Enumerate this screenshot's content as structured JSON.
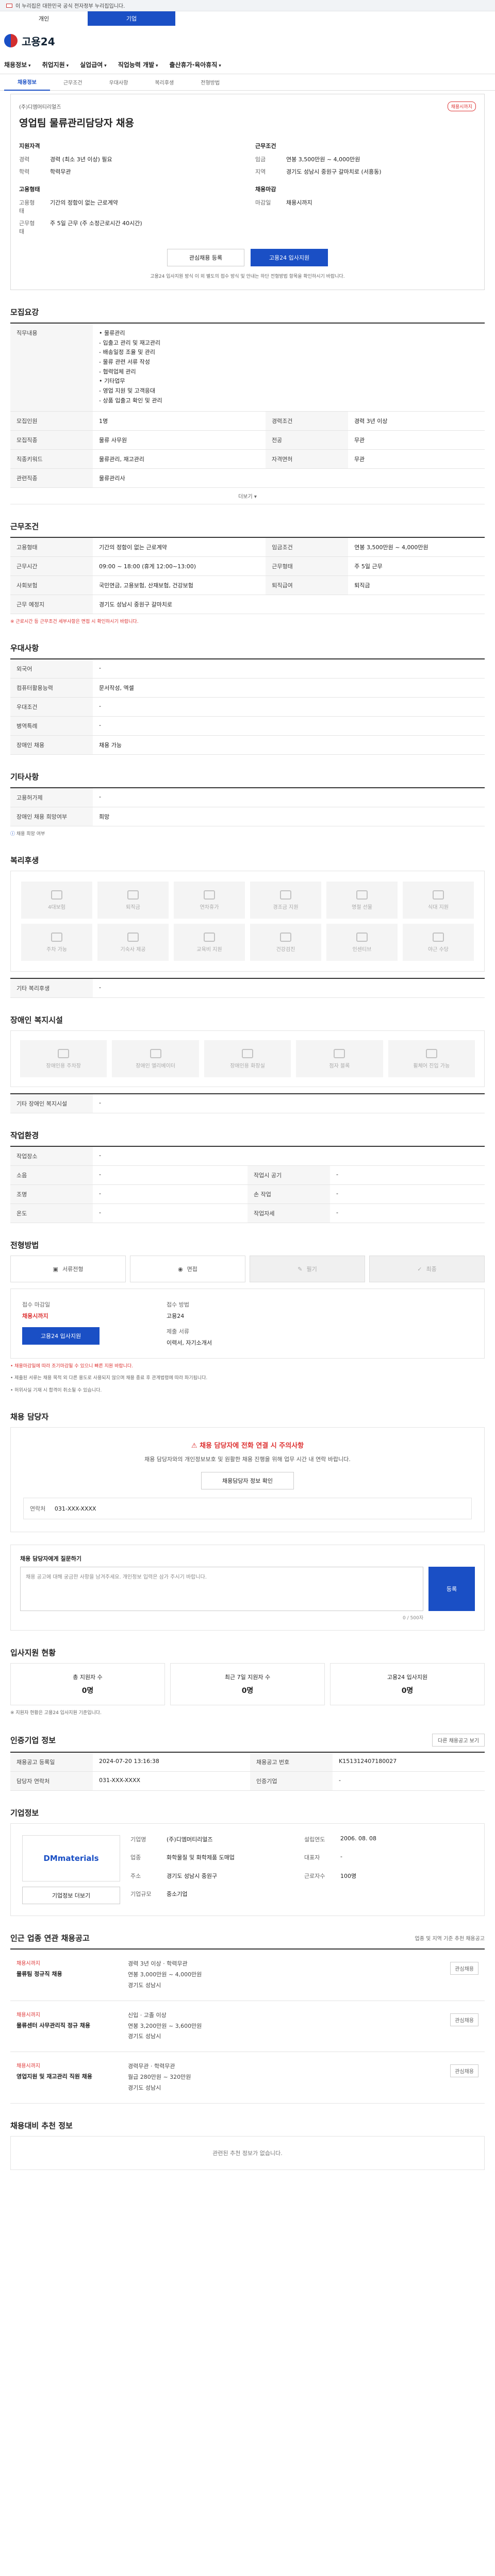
{
  "gov_banner": "이 누리집은 대한민국 공식 전자정부 누리집입니다.",
  "top_tabs": [
    "개인",
    "기업"
  ],
  "logo": "고용24",
  "gnb": [
    "채용정보",
    "취업지원",
    "실업급여",
    "직업능력 개발",
    "출산휴가·육아휴직"
  ],
  "subnav": [
    "채용정보",
    "근무조건",
    "우대사항",
    "복리후생",
    "전형방법"
  ],
  "summary": {
    "company": "(주)디엠머티리얼즈",
    "badge": "채용시까지",
    "title": "영업팀 물류관리담당자 채용",
    "left_heading": "지원자격",
    "left_kv": [
      [
        "경력",
        "경력 (최소 3년 이상) 필요"
      ],
      [
        "학력",
        "학력무관"
      ]
    ],
    "left2_heading": "고용형태",
    "left2_kv": [
      [
        "고용형태",
        "기간의 정함이 없는 근로계약"
      ],
      [
        "근무형태",
        "주 5일 근무 (주 소정근로시간 40시간)"
      ]
    ],
    "right_heading": "근무조건",
    "right_kv": [
      [
        "임금",
        "연봉 3,500만원 ~ 4,000만원"
      ],
      [
        "지역",
        "경기도 성남시 중원구 갈마치로 (서흥동)"
      ]
    ],
    "right2_heading": "채용마감",
    "right2_kv": [
      [
        "마감일",
        "채용시까지"
      ]
    ],
    "btn_scrap": "관심채용 등록",
    "btn_apply": "고용24 입사지원",
    "note": "고용24 입사지원 방식 이 외 별도의 접수 방식 및 안내는 하단 전형방법 항목을 확인하시기 바랍니다."
  },
  "sections": {
    "recruit": "모집요강",
    "conditions": "근무조건",
    "preference": "우대사항",
    "other": "기타사항",
    "welfare": "복리후생",
    "disability": "장애인 복지시설",
    "environment": "작업환경",
    "selection": "전형방법",
    "contact": "채용 담당자",
    "applicants": "입사지원 현황",
    "manager": "인증기업 정보",
    "company": "기업정보",
    "related": "인근 업종 연관 채용공고",
    "nearby": "채용대비 추천 정보"
  },
  "recruit": {
    "rows": [
      [
        "직무내용",
        "• 물류관리\n  - 입출고 관리 및 재고관리\n  - 배송일정 조율 및 관리\n  - 물류 관련 서류 작성\n  - 협력업체 관리\n• 기타업무\n  - 영업 지원 및 고객응대\n  - 상품 입출고 확인 및 관리"
      ],
      [
        "모집인원",
        "1명"
      ],
      [
        "모집직종",
        "물류 사무원"
      ],
      [
        "직종키워드",
        "물류관리, 재고관리"
      ],
      [
        "관련직종",
        "물류관리사"
      ]
    ],
    "right_rows": [
      [
        "경력조건",
        "경력 3년 이상"
      ],
      [
        "전공",
        "무관"
      ],
      [
        "자격면허",
        "무관"
      ]
    ],
    "more": "더보기 ▾"
  },
  "conditions": {
    "rows": [
      [
        "고용형태",
        "기간의 정함이 없는 근로계약",
        "임금조건",
        "연봉 3,500만원 ~ 4,000만원"
      ],
      [
        "근무시간",
        "09:00 ~ 18:00 (휴게 12:00~13:00)",
        "근무형태",
        "주 5일 근무"
      ],
      [
        "사회보험",
        "국민연금, 고용보험, 산재보험, 건강보험",
        "퇴직급여",
        "퇴직금"
      ],
      [
        "근무 예정지",
        "경기도 성남시 중원구 갈마치로",
        "",
        ""
      ]
    ],
    "note": "※ 근로시간 등 근무조건 세부사항은 면접 시 확인하시기 바랍니다."
  },
  "preference": {
    "rows": [
      [
        "외국어",
        "-"
      ],
      [
        "컴퓨터활용능력",
        "문서작성, 엑셀"
      ],
      [
        "우대조건",
        "-"
      ],
      [
        "병역특례",
        "-"
      ],
      [
        "장애인 채용",
        "채용 가능"
      ]
    ]
  },
  "other": {
    "rows": [
      [
        "고용허가제",
        "-"
      ],
      [
        "장애인 채용 희망여부",
        "희망"
      ]
    ],
    "link": "채용 희망 여부"
  },
  "welfare": {
    "items": [
      "4대보험",
      "퇴직금",
      "연차휴가",
      "경조금 지원",
      "명절 선물",
      "식대 지원",
      "주차 가능",
      "기숙사 제공",
      "교육비 지원",
      "건강검진",
      "인센티브",
      "야근 수당"
    ],
    "extra_label": "기타 복리후생",
    "extra_value": "-"
  },
  "disability": {
    "items": [
      "장애인용 주차장",
      "장애인 엘리베이터",
      "장애인용 화장실",
      "점자 블록",
      "휠체어 진입 가능"
    ],
    "extra_label": "기타 장애인 복지시설",
    "extra_value": "-"
  },
  "environment": {
    "rows": [
      [
        "작업장소",
        "-",
        "",
        ""
      ],
      [
        "소음",
        "-",
        "작업시 공기",
        "-"
      ],
      [
        "조명",
        "-",
        "손 작업",
        "-"
      ],
      [
        "온도",
        "-",
        "작업자세",
        "-"
      ]
    ]
  },
  "selection": {
    "steps": [
      "서류전형",
      "면접",
      "필기",
      "최종"
    ],
    "deadline_label": "접수 마감일",
    "deadline": "채용시까지",
    "method_label": "접수 방법",
    "method": "고용24",
    "docs_label": "제출 서류",
    "docs": "이력서, 자기소개서",
    "apply_btn": "고용24 입사지원",
    "notes": [
      "• 채용마감일에 따라 조기마감될 수 있으니 빠른 지원 바랍니다.",
      "• 제출된 서류는 채용 목적 외 다른 용도로 사용되지 않으며 채용 종료 후 관계법령에 따라 파기됩니다.",
      "• 허위사실 기재 시 합격이 취소될 수 있습니다."
    ]
  },
  "contact": {
    "warn": "채용 담당자에 전화 연결 시 주의사항",
    "text": "채용 담당자와의 개인정보보호 및 원활한 채용 진행을 위해 업무 시간 내 연락 바랍니다.",
    "btn": "채용담당자 정보 확인",
    "phone_label": "연락처",
    "phone": "031-XXX-XXXX"
  },
  "inquiry": {
    "label": "채용 담당자에게 질문하기",
    "placeholder": "채용 공고에 대해 궁금한 사항을 남겨주세요. 개인정보 입력은 삼가 주시기 바랍니다.",
    "btn": "등록",
    "count": "0 / 500자"
  },
  "applicants": {
    "items": [
      [
        "총 지원자 수",
        "0명"
      ],
      [
        "최근 7일 지원자 수",
        "0명"
      ],
      [
        "고용24 입사지원",
        "0명"
      ]
    ],
    "note": "※ 지원자 현황은 고용24 입사지원 기준입니다."
  },
  "manager": {
    "rows": [
      [
        "채용공고 등록일",
        "2024-07-20 13:16:38",
        "채용공고 번호",
        "K151312407180027"
      ],
      [
        "담당자 연락처",
        "031-XXX-XXXX",
        "인증기업",
        "-"
      ]
    ],
    "btn": "다른 채용공고 보기"
  },
  "company": {
    "logo": "DMmaterials",
    "rows": [
      [
        "기업명",
        "(주)디엠머티리얼즈",
        "설립연도",
        "2006. 08. 08"
      ],
      [
        "업종",
        "화학물질 및 화학제품 도매업",
        "대표자",
        "-"
      ],
      [
        "주소",
        "경기도 성남시 중원구",
        "근로자수",
        "100명"
      ],
      [
        "기업규모",
        "중소기업",
        "",
        ""
      ]
    ],
    "btn_more": "기업정보 더보기"
  },
  "related": {
    "heading_note": "업종 및 지역 기준 추천 채용공고",
    "jobs": [
      {
        "company": "채용시까지",
        "title": "물류팀 정규직 채용",
        "meta": [
          "경력 3년 이상 · 학력무관",
          "연봉 3,000만원 ~ 4,000만원",
          "경기도 성남시"
        ],
        "side": "관심채용"
      },
      {
        "company": "채용시까지",
        "title": "물류센터 사무관리직 정규 채용",
        "meta": [
          "신입 · 고졸 이상",
          "연봉 3,200만원 ~ 3,600만원",
          "경기도 성남시"
        ],
        "side": "관심채용"
      },
      {
        "company": "채용시까지",
        "title": "영업지원 및 재고관리 직원 채용",
        "meta": [
          "경력무관 · 학력무관",
          "월급 280만원 ~ 320만원",
          "경기도 성남시"
        ],
        "side": "관심채용"
      }
    ]
  },
  "nearby": {
    "empty": "관련된 추천 정보가 없습니다."
  }
}
